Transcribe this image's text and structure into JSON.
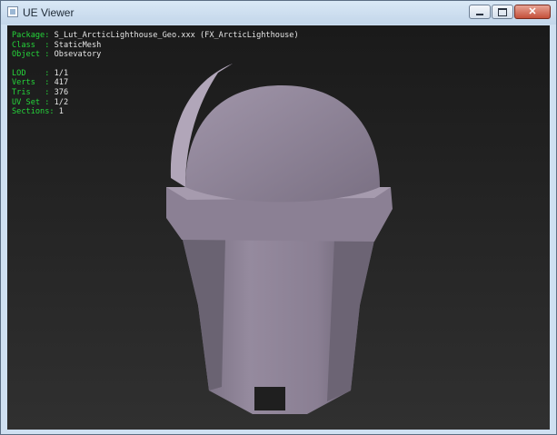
{
  "window": {
    "title": "UE Viewer",
    "icons": {
      "app": "app-icon",
      "minimize": "minimize-icon",
      "maximize": "maximize-icon",
      "close": "close-icon"
    }
  },
  "info": {
    "package_label": "Package:",
    "package_value": "S_Lut_ArcticLighthouse_Geo.xxx (FX_ArcticLighthouse)",
    "class_label": "Class  :",
    "class_value": "StaticMesh",
    "object_label": "Object :",
    "object_value": "Obsevatory",
    "lod_label": "LOD    :",
    "lod_value": "1/1",
    "verts_label": "Verts  :",
    "verts_value": "417",
    "tris_label": "Tris   :",
    "tris_value": "376",
    "uvset_label": "UV Set :",
    "uvset_value": "1/2",
    "sections_label": "Sections:",
    "sections_value": "1"
  },
  "colors": {
    "label": "#25d63a",
    "value": "#e6e6e6",
    "mesh": "#8f8499"
  }
}
